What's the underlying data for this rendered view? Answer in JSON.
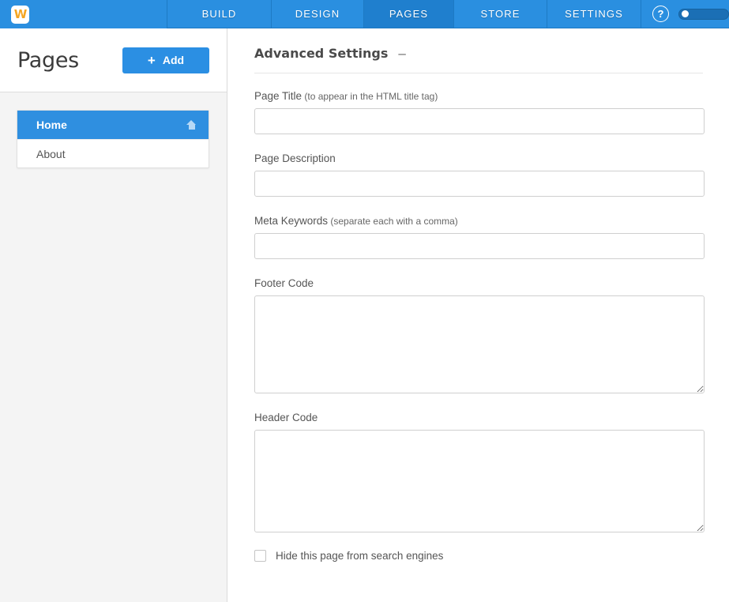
{
  "app": {
    "logo_letter": "W",
    "logo_color": "#f5a623",
    "accent_color": "#2b8fe3",
    "nav_bg_color": "#2a8fe0",
    "active_tab_color": "#1f7fce"
  },
  "topnav": {
    "tabs": [
      {
        "label": "BUILD",
        "active": false
      },
      {
        "label": "DESIGN",
        "active": false
      },
      {
        "label": "PAGES",
        "active": true
      },
      {
        "label": "STORE",
        "active": false
      },
      {
        "label": "SETTINGS",
        "active": false
      }
    ],
    "help_label": "?",
    "help_icon": "question-circle-icon"
  },
  "sidebar": {
    "title": "Pages",
    "add_button": {
      "label": "Add",
      "icon": "plus-icon",
      "plus": "+"
    },
    "items": [
      {
        "label": "Home",
        "active": true,
        "icon": "home-icon"
      },
      {
        "label": "About",
        "active": false,
        "icon": ""
      }
    ]
  },
  "main": {
    "section_title": "Advanced Settings",
    "collapse_toggle": "–",
    "fields": {
      "page_title": {
        "label": "Page Title",
        "hint": " (to appear in the HTML title tag)",
        "value": "",
        "placeholder": ""
      },
      "page_description": {
        "label": "Page Description",
        "hint": "",
        "value": "",
        "placeholder": ""
      },
      "meta_keywords": {
        "label": "Meta Keywords",
        "hint": " (separate each with a comma)",
        "value": "",
        "placeholder": ""
      },
      "footer_code": {
        "label": "Footer Code",
        "hint": "",
        "value": "",
        "placeholder": ""
      },
      "header_code": {
        "label": "Header Code",
        "hint": "",
        "value": "",
        "placeholder": ""
      }
    },
    "hide_from_search": {
      "label": "Hide this page from search engines",
      "checked": false
    }
  }
}
